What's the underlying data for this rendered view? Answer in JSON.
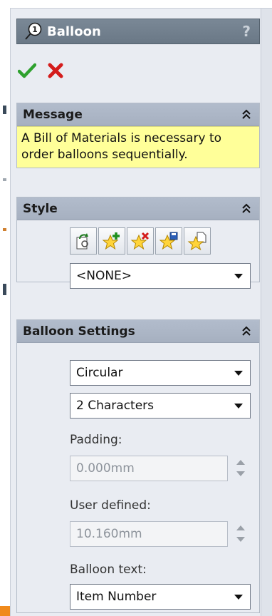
{
  "panel": {
    "title": "Balloon",
    "help_symbol": "?",
    "title_icon_glyph": "1",
    "accent_color": "#6a7886"
  },
  "actions": {
    "ok_icon": "green-checkmark-icon",
    "cancel_icon": "red-x-icon"
  },
  "message": {
    "header": "Message",
    "text": "A Bill of Materials is necessary to order balloons sequentially.",
    "bg_color": "#ffff99"
  },
  "style": {
    "header": "Style",
    "icons": [
      "apply-style-icon",
      "add-style-icon",
      "delete-style-icon",
      "save-style-icon",
      "load-style-icon"
    ],
    "selected": "<NONE>"
  },
  "balloon_settings": {
    "header": "Balloon Settings",
    "shape": "Circular",
    "size": "2 Characters",
    "padding_label": "Padding:",
    "padding_value": "0.000mm",
    "user_defined_label": "User defined:",
    "user_defined_value": "10.160mm",
    "balloon_text_label": "Balloon text:",
    "balloon_text_value": "Item Number"
  }
}
